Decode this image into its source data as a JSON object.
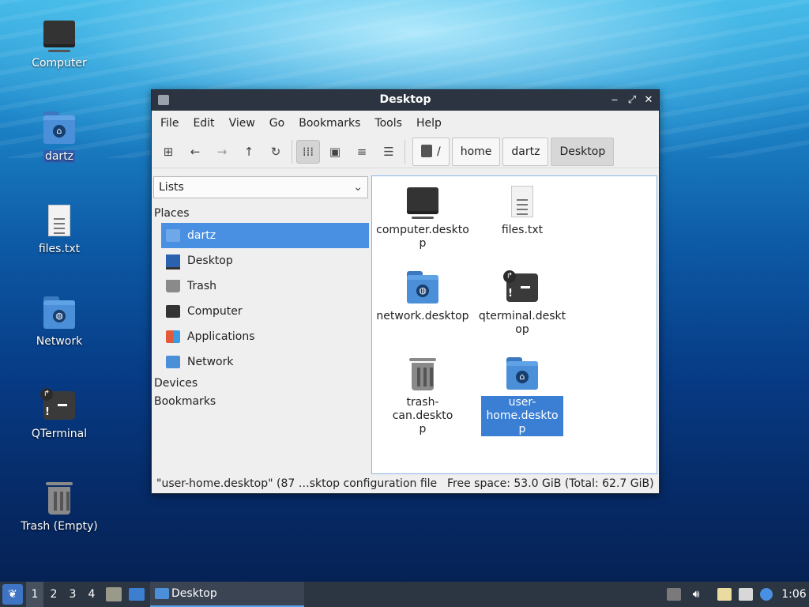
{
  "desktop": {
    "icons": [
      {
        "label": "Computer",
        "icon": "computer-icon"
      },
      {
        "label": "dartz",
        "icon": "home-folder-icon",
        "selected": true
      },
      {
        "label": "files.txt",
        "icon": "text-file-icon"
      },
      {
        "label": "Network",
        "icon": "network-folder-icon"
      },
      {
        "label": "QTerminal",
        "icon": "terminal-icon"
      },
      {
        "label": "Trash (Empty)",
        "icon": "trash-icon"
      }
    ]
  },
  "window": {
    "title": "Desktop",
    "controls": {
      "minimize": "‒",
      "maximize": "⤢",
      "close": "✕"
    },
    "menu": [
      "File",
      "Edit",
      "View",
      "Go",
      "Bookmarks",
      "Tools",
      "Help"
    ],
    "toolbar": {
      "buttons": [
        "new-tab-icon",
        "back-icon",
        "forward-icon",
        "up-icon",
        "reload-icon",
        "icon-view-icon",
        "thumbnail-view-icon",
        "compact-view-icon",
        "detailed-list-icon"
      ],
      "active_view": "icon-view-icon"
    },
    "path": {
      "root": "/",
      "segments": [
        "home",
        "dartz",
        "Desktop"
      ],
      "current": "Desktop"
    },
    "sidebar": {
      "mode_select": "Lists",
      "groups": {
        "places": "Places",
        "devices": "Devices",
        "bookmarks": "Bookmarks"
      },
      "places": [
        {
          "label": "dartz",
          "icon": "home-icon",
          "selected": true
        },
        {
          "label": "Desktop",
          "icon": "desktop-icon"
        },
        {
          "label": "Trash",
          "icon": "trash-icon"
        },
        {
          "label": "Computer",
          "icon": "computer-icon"
        },
        {
          "label": "Applications",
          "icon": "applications-icon"
        },
        {
          "label": "Network",
          "icon": "network-icon"
        }
      ]
    },
    "files": [
      {
        "name": "computer.desktop",
        "icon": "computer-icon"
      },
      {
        "name": "files.txt",
        "icon": "text-file-icon"
      },
      {
        "name": "network.desktop",
        "icon": "network-folder-icon"
      },
      {
        "name": "qterminal.desktop",
        "icon": "terminal-icon"
      },
      {
        "name": "trash-can.desktop",
        "icon": "trash-icon"
      },
      {
        "name": "user-home.desktop",
        "icon": "home-folder-icon",
        "selected": true
      }
    ],
    "status": {
      "left": "\"user-home.desktop\" (87 …sktop configuration file",
      "right": "Free space: 53.0 GiB (Total: 62.7 GiB)"
    }
  },
  "taskbar": {
    "desktops": [
      "1",
      "2",
      "3",
      "4"
    ],
    "active_desktop": "1",
    "task": "Desktop",
    "clock": "1:06",
    "colors": {
      "panel": "#2c3542",
      "accent": "#4a90e2"
    }
  }
}
